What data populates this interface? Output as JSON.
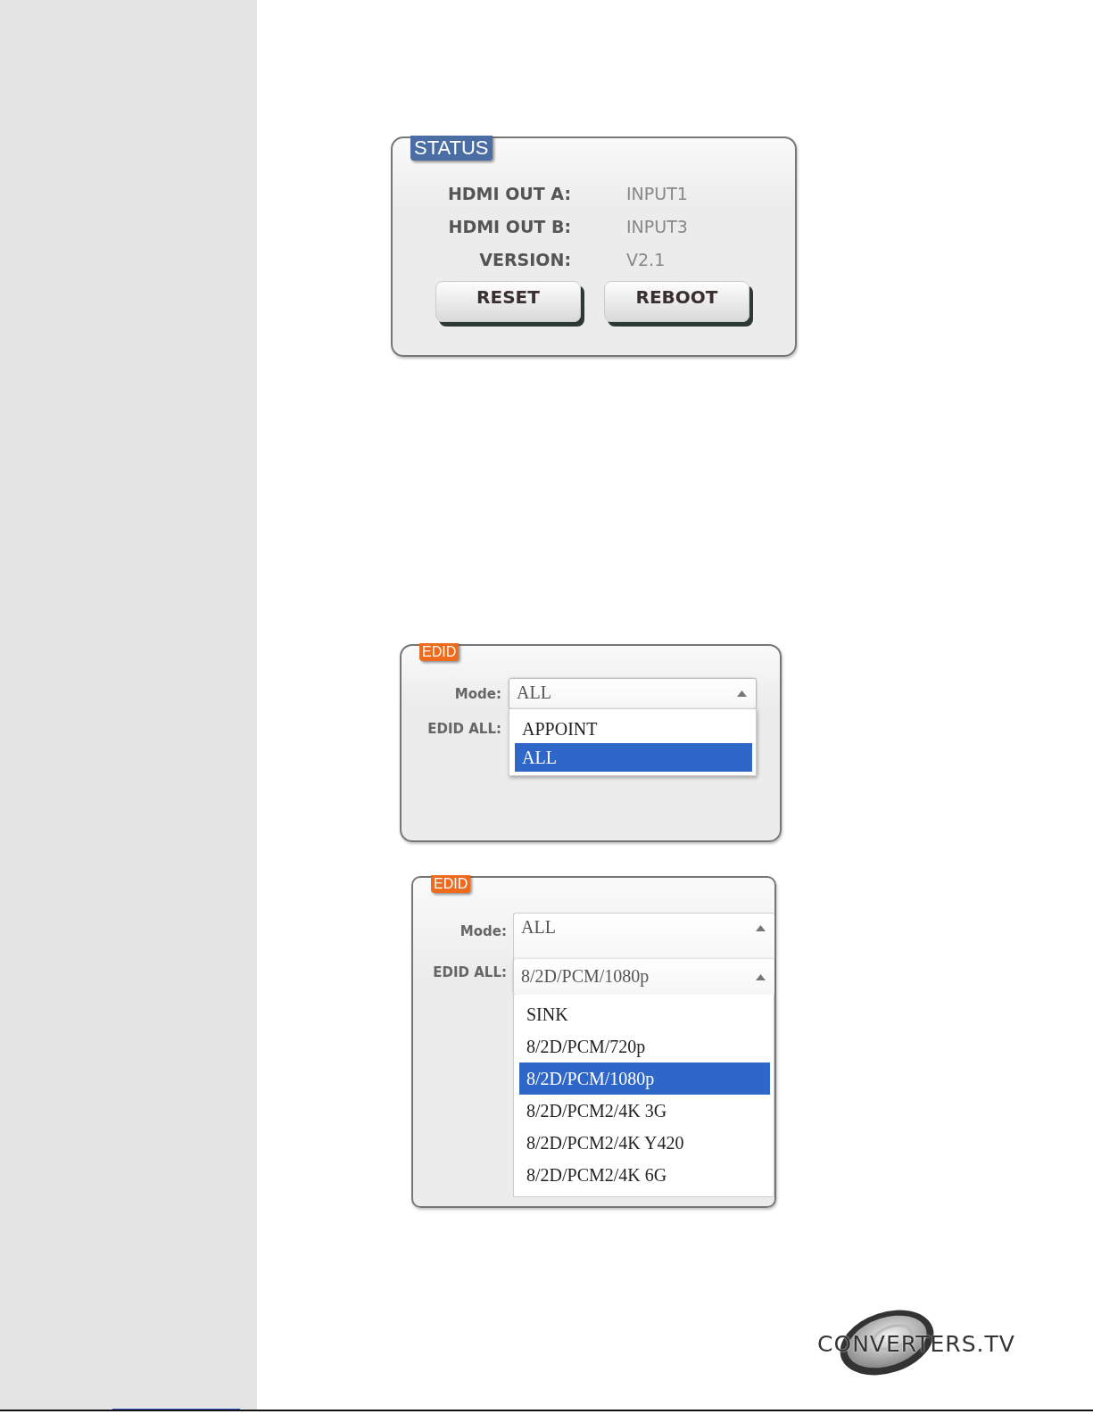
{
  "status": {
    "title": "STATUS",
    "rows": [
      {
        "label": "HDMI OUT A:",
        "value": "INPUT1"
      },
      {
        "label": "HDMI OUT B:",
        "value": "INPUT3"
      },
      {
        "label": "VERSION:",
        "value": "V2.1"
      }
    ],
    "buttons": [
      "RESET",
      "REBOOT"
    ]
  },
  "edid_panels": [
    {
      "title": "EDID",
      "fields": [
        {
          "label": "Mode:",
          "value": "ALL",
          "open": true,
          "options": [
            {
              "label": "APPOINT",
              "selected": false
            },
            {
              "label": "ALL",
              "selected": true
            }
          ]
        },
        {
          "label": "EDID ALL:"
        }
      ]
    },
    {
      "title": "EDID",
      "fields": [
        {
          "label": "Mode:",
          "value": "ALL",
          "open": false
        },
        {
          "label": "EDID ALL:",
          "value": "8/2D/PCM/1080p",
          "open": true,
          "options": [
            {
              "label": "SINK",
              "selected": false
            },
            {
              "label": "8/2D/PCM/720p",
              "selected": false
            },
            {
              "label": "8/2D/PCM/1080p",
              "selected": true
            },
            {
              "label": "8/2D/PCM2/4K 3G",
              "selected": false
            },
            {
              "label": "8/2D/PCM2/4K Y420",
              "selected": false
            },
            {
              "label": "8/2D/PCM2/4K 6G",
              "selected": false
            }
          ]
        }
      ]
    }
  ],
  "logo": {
    "text": "CONVERTERS.TV"
  }
}
